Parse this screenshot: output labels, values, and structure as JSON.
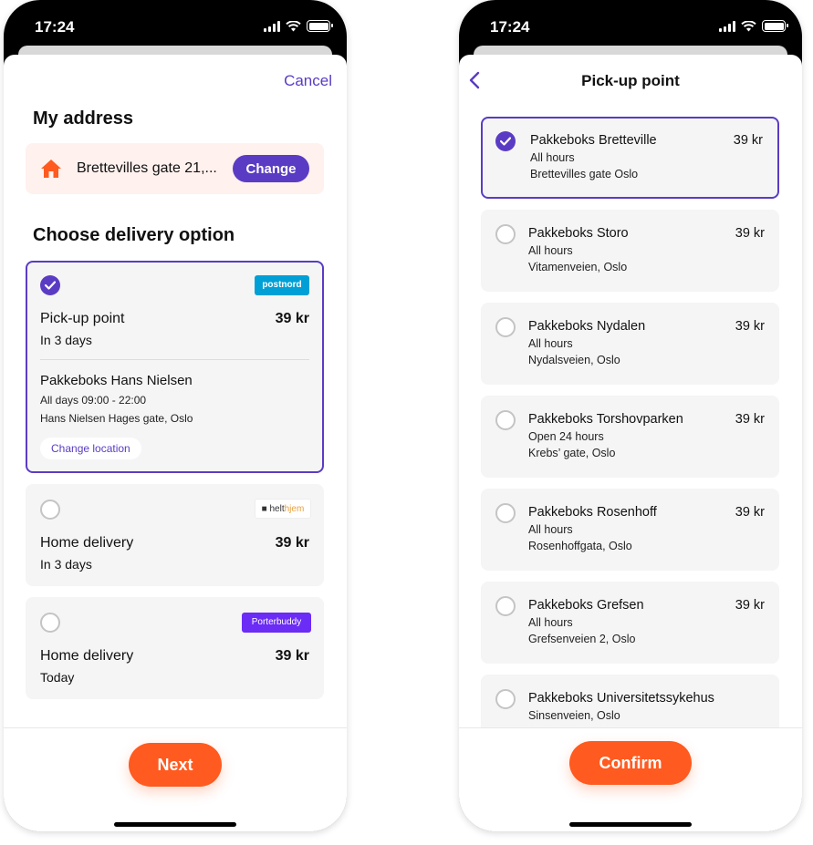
{
  "status_time": "17:24",
  "left": {
    "cancel": "Cancel",
    "my_address_heading": "My address",
    "address": "Brettevilles gate 21,...",
    "change": "Change",
    "delivery_heading": "Choose delivery option",
    "options": [
      {
        "carrier": "postnord",
        "title": "Pick-up point",
        "price": "39 kr",
        "eta": "In 3 days",
        "selected": true,
        "location_name": "Pakkeboks Hans Nielsen",
        "location_hours": "All days 09:00 - 22:00",
        "location_address": "Hans Nielsen Hages gate, Oslo",
        "change_location": "Change location"
      },
      {
        "carrier_a": "helt",
        "carrier_b": "hjem",
        "title": "Home delivery",
        "price": "39 kr",
        "eta": "In 3 days",
        "selected": false
      },
      {
        "carrier": "Porterbuddy",
        "title": "Home delivery",
        "price": "39 kr",
        "eta": "Today",
        "selected": false
      }
    ],
    "next": "Next"
  },
  "right": {
    "title": "Pick-up point",
    "points": [
      {
        "name": "Pakkeboks Bretteville",
        "price": "39 kr",
        "hours": "All hours",
        "address": "Brettevilles gate Oslo",
        "selected": true
      },
      {
        "name": "Pakkeboks Storo",
        "price": "39 kr",
        "hours": "All hours",
        "address": "Vitamenveien, Oslo",
        "selected": false
      },
      {
        "name": "Pakkeboks Nydalen",
        "price": "39 kr",
        "hours": "All hours",
        "address": "Nydalsveien, Oslo",
        "selected": false
      },
      {
        "name": "Pakkeboks Torshovparken",
        "price": "39 kr",
        "hours": "Open 24 hours",
        "address": "Krebs’ gate, Oslo",
        "selected": false
      },
      {
        "name": "Pakkeboks Rosenhoff",
        "price": "39 kr",
        "hours": "All hours",
        "address": "Rosenhoffgata, Oslo",
        "selected": false
      },
      {
        "name": "Pakkeboks Grefsen",
        "price": "39 kr",
        "hours": "All hours",
        "address": "Grefsenveien 2, Oslo",
        "selected": false
      },
      {
        "name": "Pakkeboks Universitetssykehus",
        "price": "",
        "hours": "Sinsenveien, Oslo",
        "address": "",
        "selected": false
      }
    ],
    "confirm": "Confirm"
  },
  "colors": {
    "accent": "#5a3cc4",
    "cta": "#ff5a1f",
    "address_bg": "#fff1ee",
    "card_bg": "#f5f5f5"
  }
}
